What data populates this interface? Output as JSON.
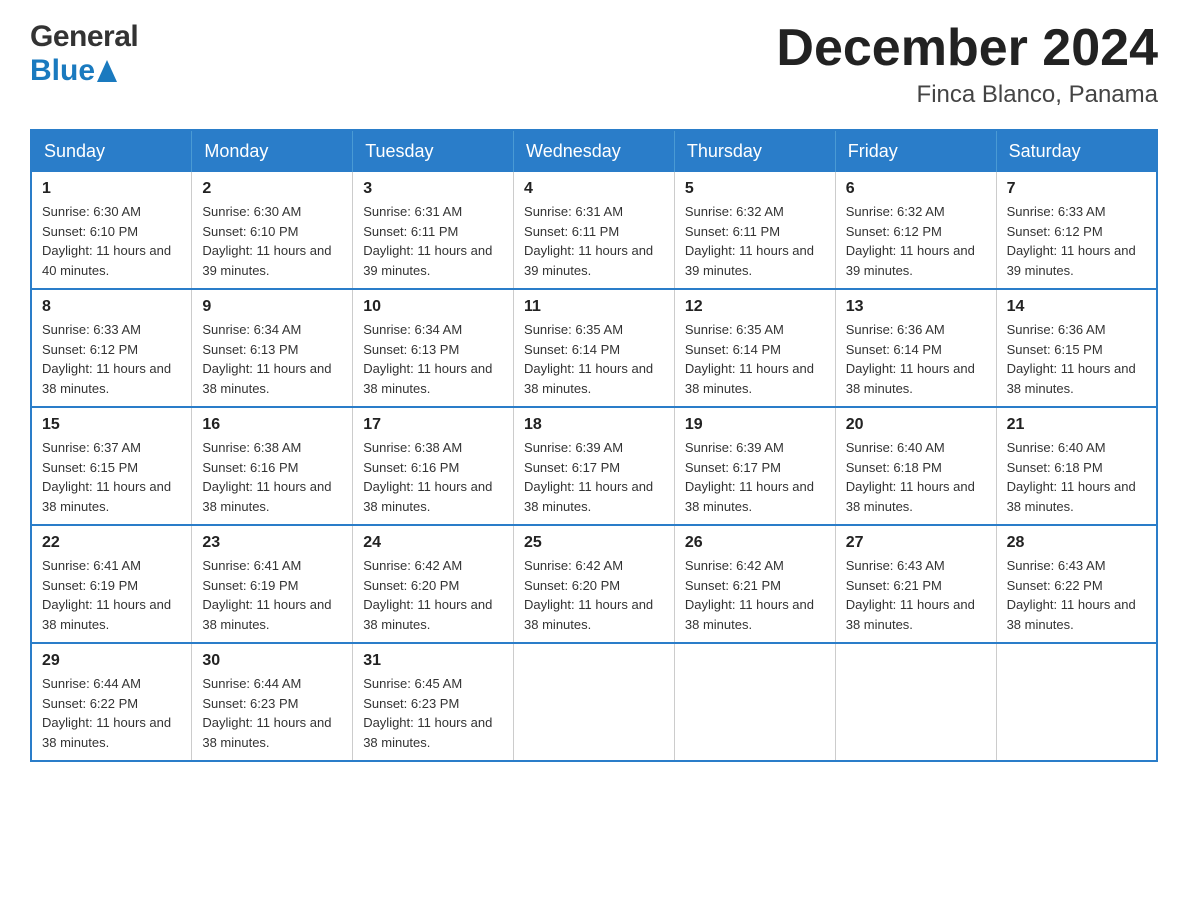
{
  "header": {
    "logo_line1": "General",
    "logo_line2": "Blue",
    "month_title": "December 2024",
    "location": "Finca Blanco, Panama"
  },
  "days_of_week": [
    "Sunday",
    "Monday",
    "Tuesday",
    "Wednesday",
    "Thursday",
    "Friday",
    "Saturday"
  ],
  "weeks": [
    [
      {
        "day": "1",
        "sunrise": "6:30 AM",
        "sunset": "6:10 PM",
        "daylight": "11 hours and 40 minutes."
      },
      {
        "day": "2",
        "sunrise": "6:30 AM",
        "sunset": "6:10 PM",
        "daylight": "11 hours and 39 minutes."
      },
      {
        "day": "3",
        "sunrise": "6:31 AM",
        "sunset": "6:11 PM",
        "daylight": "11 hours and 39 minutes."
      },
      {
        "day": "4",
        "sunrise": "6:31 AM",
        "sunset": "6:11 PM",
        "daylight": "11 hours and 39 minutes."
      },
      {
        "day": "5",
        "sunrise": "6:32 AM",
        "sunset": "6:11 PM",
        "daylight": "11 hours and 39 minutes."
      },
      {
        "day": "6",
        "sunrise": "6:32 AM",
        "sunset": "6:12 PM",
        "daylight": "11 hours and 39 minutes."
      },
      {
        "day": "7",
        "sunrise": "6:33 AM",
        "sunset": "6:12 PM",
        "daylight": "11 hours and 39 minutes."
      }
    ],
    [
      {
        "day": "8",
        "sunrise": "6:33 AM",
        "sunset": "6:12 PM",
        "daylight": "11 hours and 38 minutes."
      },
      {
        "day": "9",
        "sunrise": "6:34 AM",
        "sunset": "6:13 PM",
        "daylight": "11 hours and 38 minutes."
      },
      {
        "day": "10",
        "sunrise": "6:34 AM",
        "sunset": "6:13 PM",
        "daylight": "11 hours and 38 minutes."
      },
      {
        "day": "11",
        "sunrise": "6:35 AM",
        "sunset": "6:14 PM",
        "daylight": "11 hours and 38 minutes."
      },
      {
        "day": "12",
        "sunrise": "6:35 AM",
        "sunset": "6:14 PM",
        "daylight": "11 hours and 38 minutes."
      },
      {
        "day": "13",
        "sunrise": "6:36 AM",
        "sunset": "6:14 PM",
        "daylight": "11 hours and 38 minutes."
      },
      {
        "day": "14",
        "sunrise": "6:36 AM",
        "sunset": "6:15 PM",
        "daylight": "11 hours and 38 minutes."
      }
    ],
    [
      {
        "day": "15",
        "sunrise": "6:37 AM",
        "sunset": "6:15 PM",
        "daylight": "11 hours and 38 minutes."
      },
      {
        "day": "16",
        "sunrise": "6:38 AM",
        "sunset": "6:16 PM",
        "daylight": "11 hours and 38 minutes."
      },
      {
        "day": "17",
        "sunrise": "6:38 AM",
        "sunset": "6:16 PM",
        "daylight": "11 hours and 38 minutes."
      },
      {
        "day": "18",
        "sunrise": "6:39 AM",
        "sunset": "6:17 PM",
        "daylight": "11 hours and 38 minutes."
      },
      {
        "day": "19",
        "sunrise": "6:39 AM",
        "sunset": "6:17 PM",
        "daylight": "11 hours and 38 minutes."
      },
      {
        "day": "20",
        "sunrise": "6:40 AM",
        "sunset": "6:18 PM",
        "daylight": "11 hours and 38 minutes."
      },
      {
        "day": "21",
        "sunrise": "6:40 AM",
        "sunset": "6:18 PM",
        "daylight": "11 hours and 38 minutes."
      }
    ],
    [
      {
        "day": "22",
        "sunrise": "6:41 AM",
        "sunset": "6:19 PM",
        "daylight": "11 hours and 38 minutes."
      },
      {
        "day": "23",
        "sunrise": "6:41 AM",
        "sunset": "6:19 PM",
        "daylight": "11 hours and 38 minutes."
      },
      {
        "day": "24",
        "sunrise": "6:42 AM",
        "sunset": "6:20 PM",
        "daylight": "11 hours and 38 minutes."
      },
      {
        "day": "25",
        "sunrise": "6:42 AM",
        "sunset": "6:20 PM",
        "daylight": "11 hours and 38 minutes."
      },
      {
        "day": "26",
        "sunrise": "6:42 AM",
        "sunset": "6:21 PM",
        "daylight": "11 hours and 38 minutes."
      },
      {
        "day": "27",
        "sunrise": "6:43 AM",
        "sunset": "6:21 PM",
        "daylight": "11 hours and 38 minutes."
      },
      {
        "day": "28",
        "sunrise": "6:43 AM",
        "sunset": "6:22 PM",
        "daylight": "11 hours and 38 minutes."
      }
    ],
    [
      {
        "day": "29",
        "sunrise": "6:44 AM",
        "sunset": "6:22 PM",
        "daylight": "11 hours and 38 minutes."
      },
      {
        "day": "30",
        "sunrise": "6:44 AM",
        "sunset": "6:23 PM",
        "daylight": "11 hours and 38 minutes."
      },
      {
        "day": "31",
        "sunrise": "6:45 AM",
        "sunset": "6:23 PM",
        "daylight": "11 hours and 38 minutes."
      },
      null,
      null,
      null,
      null
    ]
  ],
  "labels": {
    "sunrise_prefix": "Sunrise: ",
    "sunset_prefix": "Sunset: ",
    "daylight_prefix": "Daylight: "
  }
}
